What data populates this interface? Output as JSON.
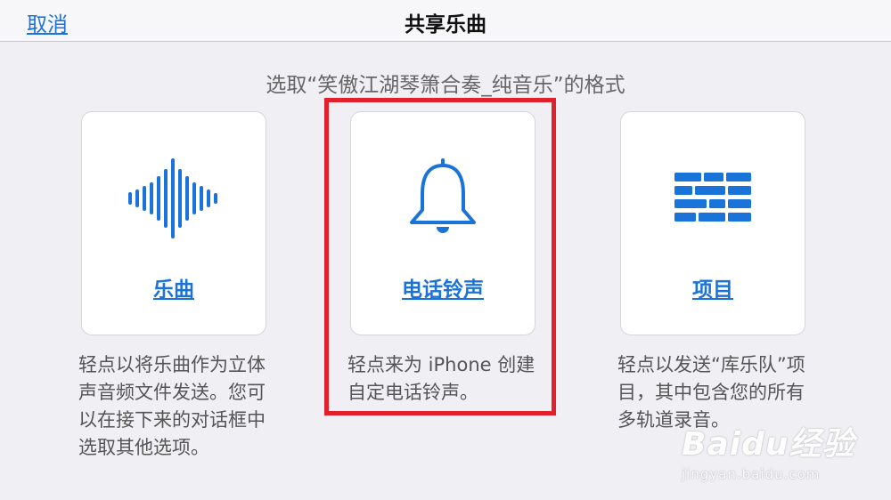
{
  "navbar": {
    "cancel_label": "取消",
    "title": "共享乐曲"
  },
  "subtitle": "选取“笑傲江湖琴箫合奏_纯音乐”的格式",
  "options": [
    {
      "icon": "waveform-icon",
      "label": "乐曲",
      "description": "轻点以将乐曲作为立体声音频文件发送。您可以在接下来的对话框中选取其他选项。"
    },
    {
      "icon": "bell-icon",
      "label": "电话铃声",
      "description": "轻点来为 iPhone 创建自定电话铃声。"
    },
    {
      "icon": "tracks-icon",
      "label": "项目",
      "description": "轻点以发送“库乐队”项目，其中包含您的所有多轨道录音。"
    }
  ],
  "watermark": {
    "logo": "Baidu经验",
    "url": "jingyan.baidu.com"
  },
  "colors": {
    "accent": "#1a73d9",
    "highlight": "#e0202b",
    "background": "#efeff4"
  }
}
